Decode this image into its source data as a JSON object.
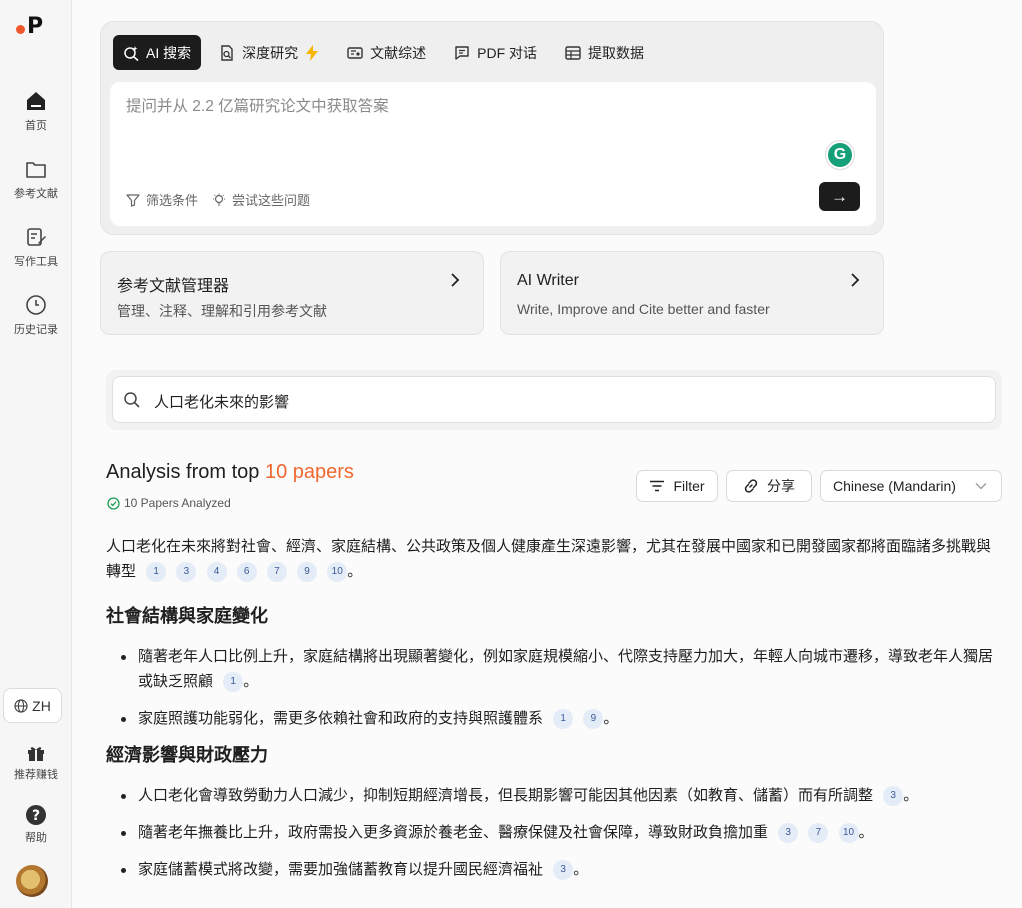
{
  "logo_text": "P",
  "sidebar": {
    "items": [
      {
        "label": "首页",
        "icon": "home-icon"
      },
      {
        "label": "参考文献",
        "icon": "folder-icon"
      },
      {
        "label": "写作工具",
        "icon": "edit-icon"
      },
      {
        "label": "历史记录",
        "icon": "clock-icon"
      }
    ],
    "language": "ZH",
    "referral_label": "推荐赚钱",
    "help_label": "帮助"
  },
  "search": {
    "tabs": [
      {
        "label": "AI 搜索",
        "icon": "sparkle-search-icon",
        "active": true
      },
      {
        "label": "深度研究",
        "icon": "deep-research-icon",
        "active": false
      },
      {
        "label": "文献综述",
        "icon": "review-icon",
        "active": false
      },
      {
        "label": "PDF 对话",
        "icon": "chat-icon",
        "active": false
      },
      {
        "label": "提取数据",
        "icon": "table-icon",
        "active": false
      }
    ],
    "placeholder": "提问并从 2.2 亿篇研究论文中获取答案",
    "filter_label": "筛选条件",
    "try_label": "尝试这些问题",
    "send_glyph": "→",
    "grammarly_glyph": "G"
  },
  "features": [
    {
      "title": "参考文献管理器",
      "desc": "管理、注释、理解和引用参考文献"
    },
    {
      "title": "AI Writer",
      "desc": "Write, Improve and Cite better and faster"
    }
  ],
  "query": "人口老化未來的影響",
  "analysis": {
    "title_prefix": "Analysis from top ",
    "title_highlight": "10 papers",
    "analyzed_label": "10 Papers Analyzed",
    "filter_label": "Filter",
    "share_label": "分享",
    "language_select": "Chinese (Mandarin)"
  },
  "content": {
    "intro": {
      "text": "人口老化在未來將對社會、經濟、家庭結構、公共政策及個人健康產生深遠影響，尤其在發展中國家和已開發國家都將面臨諸多挑戰與轉型",
      "cites": [
        "1",
        "3",
        "4",
        "6",
        "7",
        "9",
        "10"
      ]
    },
    "sections": [
      {
        "heading": "社會結構與家庭變化",
        "bullets": [
          {
            "text": "隨著老年人口比例上升，家庭結構將出現顯著變化，例如家庭規模縮小、代際支持壓力加大，年輕人向城市遷移，導致老年人獨居或缺乏照顧",
            "cites": [
              "1"
            ]
          },
          {
            "text": "家庭照護功能弱化，需更多依賴社會和政府的支持與照護體系",
            "cites": [
              "1",
              "9"
            ]
          }
        ]
      },
      {
        "heading": "經濟影響與財政壓力",
        "bullets": [
          {
            "text": "人口老化會導致勞動力人口減少，抑制短期經濟增長，但長期影響可能因其他因素（如教育、儲蓄）而有所調整",
            "cites": [
              "3"
            ]
          },
          {
            "text": "隨著老年撫養比上升，政府需投入更多資源於養老金、醫療保健及社會保障，導致財政負擔加重",
            "cites": [
              "3",
              "7",
              "10"
            ]
          },
          {
            "text": "家庭儲蓄模式將改變，需要加強儲蓄教育以提升國民經濟福祉",
            "cites": [
              "3"
            ]
          }
        ]
      }
    ]
  },
  "colors": {
    "accent": "#f0672f",
    "brand_dot": "#f0572b",
    "cite_bg": "#e4ecf7",
    "cite_text": "#3b5998",
    "dark": "#1c1c1c"
  }
}
